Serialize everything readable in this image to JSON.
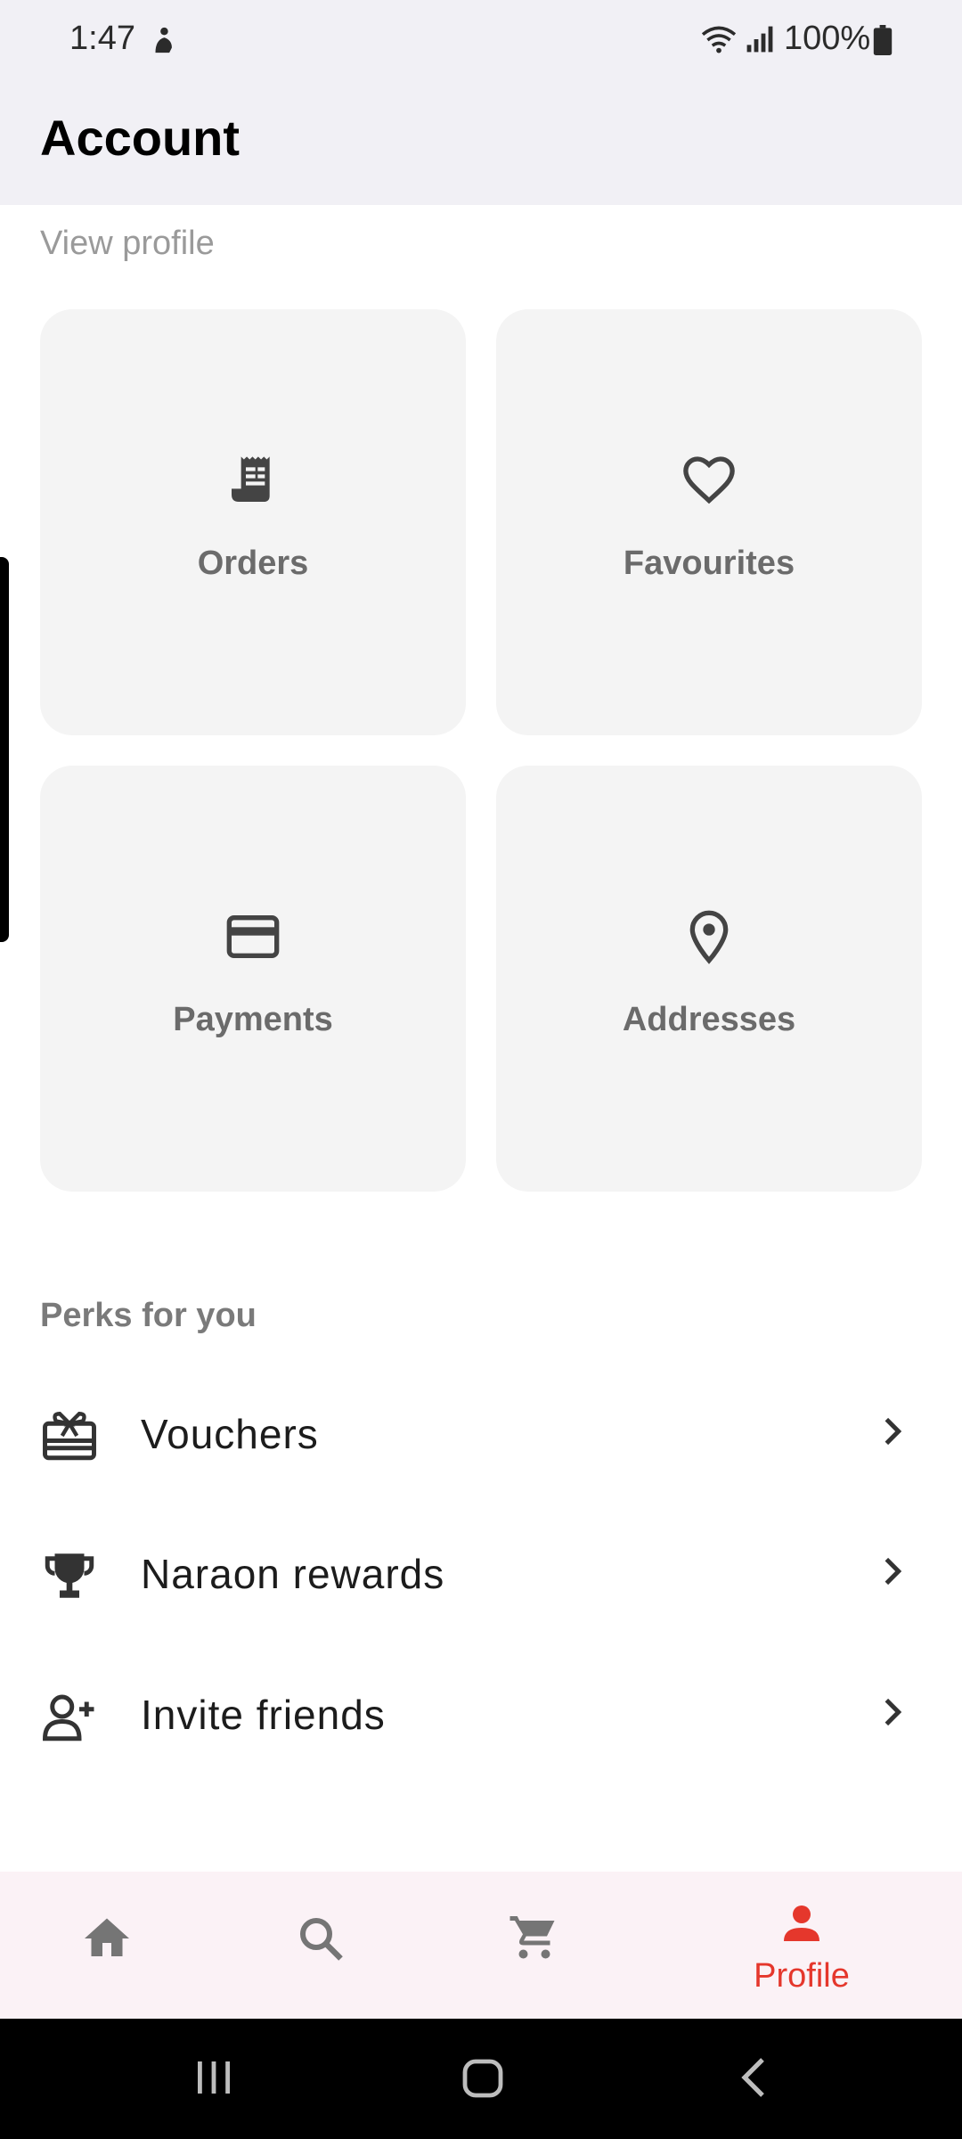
{
  "status_bar": {
    "time": "1:47",
    "battery": "100%",
    "icons": [
      "cast-icon",
      "wifi-icon",
      "signal-icon",
      "battery-icon"
    ]
  },
  "app_bar": {
    "title": "Account"
  },
  "profile": {
    "view_profile": "View profile"
  },
  "tiles": [
    {
      "label": "Orders",
      "icon": "receipt-icon"
    },
    {
      "label": "Favourites",
      "icon": "heart-icon"
    },
    {
      "label": "Payments",
      "icon": "credit-card-icon"
    },
    {
      "label": "Addresses",
      "icon": "location-pin-icon"
    }
  ],
  "perks": {
    "title": "Perks for you",
    "items": [
      {
        "label": "Vouchers",
        "icon": "gift-card-icon"
      },
      {
        "label": "Naraon rewards",
        "icon": "trophy-icon"
      },
      {
        "label": "Invite friends",
        "icon": "add-person-icon"
      }
    ]
  },
  "bottom_nav": {
    "items": [
      {
        "icon": "home-icon"
      },
      {
        "icon": "search-icon"
      },
      {
        "icon": "cart-icon"
      },
      {
        "icon": "person-icon",
        "label": "Profile",
        "active": true
      }
    ],
    "active_color": "#e5372c"
  },
  "colors": {
    "header_bg": "#f1f0f5",
    "tile_bg": "#f4f4f4",
    "accent": "#e5372c",
    "nav_bg": "#fbf2f6"
  }
}
